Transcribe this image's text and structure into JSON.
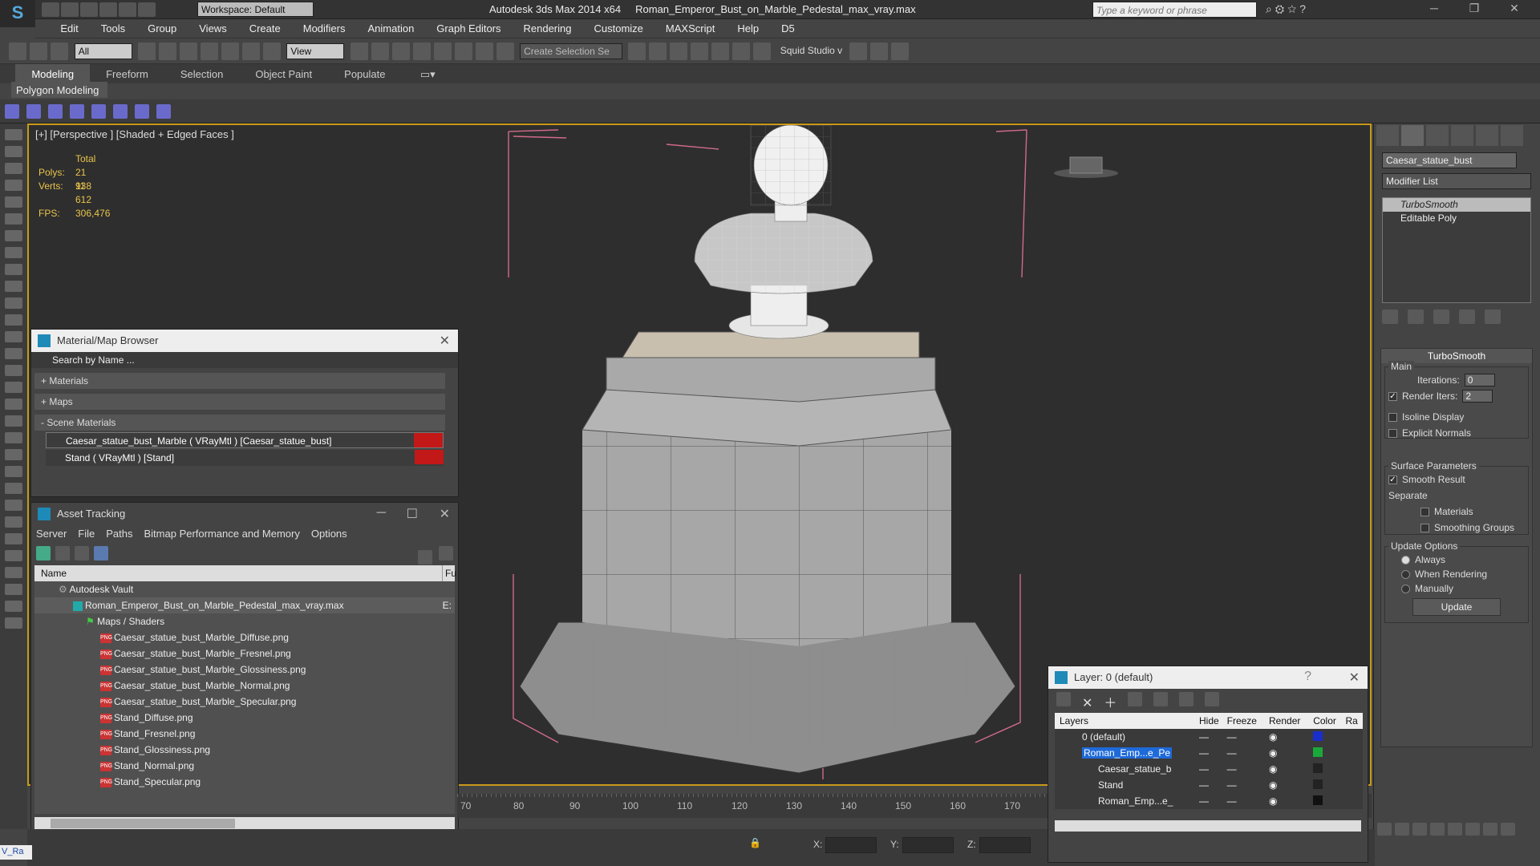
{
  "app": {
    "title": "Autodesk 3ds Max  2014 x64",
    "file": "Roman_Emperor_Bust_on_Marble_Pedestal_max_vray.max",
    "workspace": "Workspace: Default",
    "search_placeholder": "Type a keyword or phrase"
  },
  "menu": [
    "Edit",
    "Tools",
    "Group",
    "Views",
    "Create",
    "Modifiers",
    "Animation",
    "Graph Editors",
    "Rendering",
    "Customize",
    "MAXScript",
    "Help",
    "D5"
  ],
  "toolbar": {
    "filter": "All",
    "refcoord": "View",
    "selset": "Create Selection Se",
    "squid": "Squid Studio v"
  },
  "ribbon": {
    "tabs": [
      "Modeling",
      "Freeform",
      "Selection",
      "Object Paint",
      "Populate"
    ],
    "panel": "Polygon Modeling"
  },
  "viewport": {
    "label": "[+] [Perspective ] [Shaded + Edged Faces ]",
    "stats": {
      "total": "Total",
      "polys_label": "Polys:",
      "polys": "21 938",
      "verts_label": "Verts:",
      "verts": "11 612",
      "fps_label": "FPS:",
      "fps": "306,476"
    }
  },
  "material_browser": {
    "title": "Material/Map Browser",
    "search": "Search by Name ...",
    "sections": [
      "+ Materials",
      "+ Maps",
      "- Scene Materials"
    ],
    "materials": [
      "Caesar_statue_bust_Marble  ( VRayMtl ) [Caesar_statue_bust]",
      "Stand  ( VRayMtl ) [Stand]"
    ]
  },
  "asset_tracking": {
    "title": "Asset Tracking",
    "menu": [
      "Server",
      "File",
      "Paths",
      "Bitmap Performance and Memory",
      "Options"
    ],
    "col_name": "Name",
    "col_f": "Fu",
    "vault": "Autodesk Vault",
    "maxfile": "Roman_Emperor_Bust_on_Marble_Pedestal_max_vray.max",
    "maxfile_status": "E:",
    "maps": "Maps / Shaders",
    "files": [
      "Caesar_statue_bust_Marble_Diffuse.png",
      "Caesar_statue_bust_Marble_Fresnel.png",
      "Caesar_statue_bust_Marble_Glossiness.png",
      "Caesar_statue_bust_Marble_Normal.png",
      "Caesar_statue_bust_Marble_Specular.png",
      "Stand_Diffuse.png",
      "Stand_Fresnel.png",
      "Stand_Glossiness.png",
      "Stand_Normal.png",
      "Stand_Specular.png"
    ]
  },
  "command_panel": {
    "object_name": "Caesar_statue_bust",
    "modifier_list": "Modifier List",
    "stack": [
      "TurboSmooth",
      "Editable Poly"
    ],
    "rollout": "TurboSmooth",
    "main": "Main",
    "iterations_label": "Iterations:",
    "iterations": "0",
    "render_iters_label": "Render Iters:",
    "render_iters": "2",
    "isoline": "Isoline Display",
    "explicit": "Explicit Normals",
    "surface": "Surface Parameters",
    "smooth_result": "Smooth Result",
    "separate": "Separate",
    "materials": "Materials",
    "smoothing_groups": "Smoothing Groups",
    "update_options": "Update Options",
    "always": "Always",
    "when_rendering": "When Rendering",
    "manually": "Manually",
    "update": "Update"
  },
  "layer_panel": {
    "title": "Layer: 0 (default)",
    "headers": [
      "Layers",
      "Hide",
      "Freeze",
      "Render",
      "Color",
      "Ra"
    ],
    "rows": [
      {
        "name": "0 (default)",
        "color": "#1a2ecc"
      },
      {
        "name": "Roman_Emp...e_Pe",
        "color": "#1aa83a"
      },
      {
        "name": "Caesar_statue_b",
        "color": "#222222"
      },
      {
        "name": "Stand",
        "color": "#222222"
      },
      {
        "name": "Roman_Emp...e_",
        "color": "#111111"
      }
    ]
  },
  "timeline": {
    "ticks": [
      "70",
      "80",
      "90",
      "100",
      "110",
      "120",
      "130",
      "140",
      "150",
      "160",
      "170"
    ]
  },
  "status": {
    "x": "X:",
    "y": "Y:",
    "z": "Z:",
    "script": "V_Ra"
  }
}
